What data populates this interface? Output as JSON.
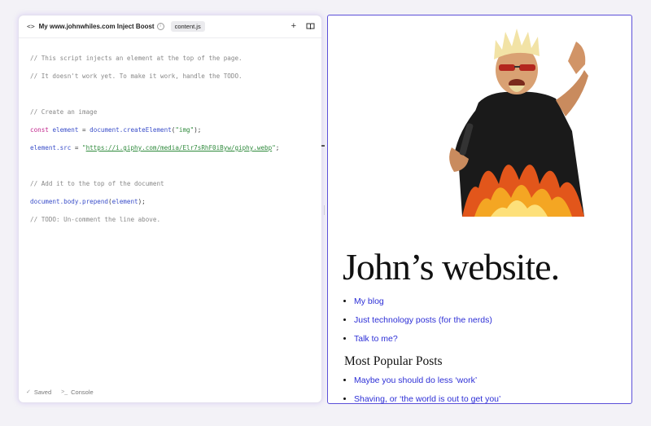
{
  "editor": {
    "boost_name": "My www.johnwhiles.com Inject Boost",
    "file_tab": "content.js",
    "code": {
      "c1": "// This script injects an element at the top of the page.",
      "c2": "// It doesn't work yet. To make it work, handle the TODO.",
      "c3": "// Create an image",
      "l4_kw": "const",
      "l4_var": "element",
      "l4_eq": " = ",
      "l4_call": "document.createElement",
      "l4_open": "(",
      "l4_str": "\"img\"",
      "l4_close": ");",
      "l5_var": "element.src",
      "l5_eq": " = ",
      "l5_q1": "\"",
      "l5_url": "https://i.giphy.com/media/Elr7sRhF0iByw/giphy.webp",
      "l5_q2": "\"",
      "l5_end": ";",
      "c6": "// Add it to the top of the document",
      "l7_call": "document.body.prepend",
      "l7_open": "(",
      "l7_var": "element",
      "l7_close": ");",
      "c8": "// TODO: Un-comment the line above."
    },
    "footer": {
      "saved_label": "Saved",
      "console_label": "Console"
    }
  },
  "preview": {
    "site_title": "John’s website.",
    "nav_links": [
      "My blog",
      "Just technology posts (for the nerds)",
      "Talk to me?"
    ],
    "popular_heading": "Most Popular Posts",
    "popular_links": [
      "Maybe you should do less ‘work’",
      "Shaving, or ‘the world is out to get you’"
    ]
  },
  "colors": {
    "accent": "#5b4fd9",
    "link": "#2c2ed6"
  },
  "icons": [
    "code-icon",
    "info-icon",
    "plus-icon",
    "book-icon",
    "check-icon",
    "terminal-icon"
  ]
}
